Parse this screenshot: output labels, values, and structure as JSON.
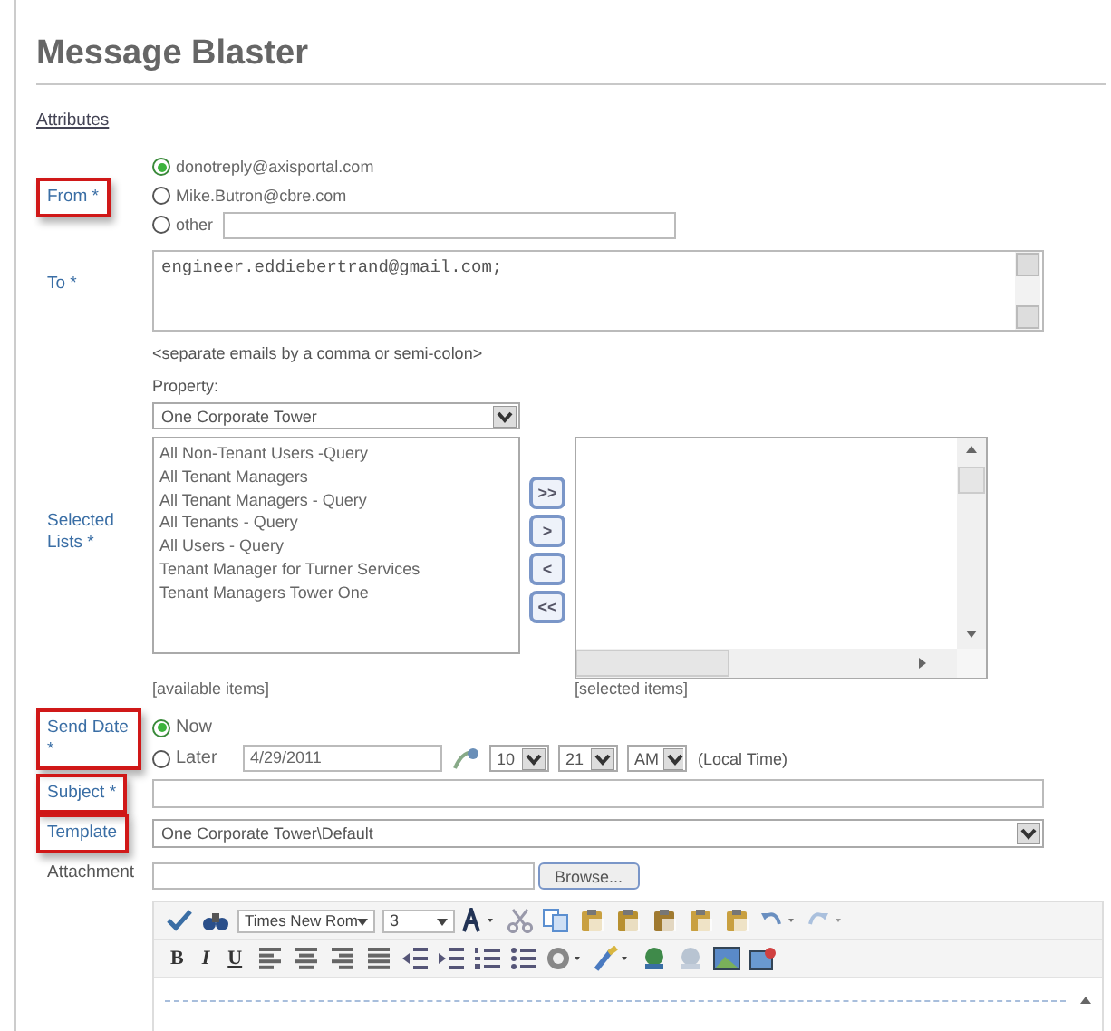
{
  "title": "Message Blaster",
  "attributes_link": "Attributes",
  "from": {
    "label": "From *",
    "highlighted": true,
    "options": [
      {
        "label": "donotreply@axisportal.com",
        "selected": true,
        "kind": "plain"
      },
      {
        "label": "Mike.Butron@cbre.com",
        "selected": false,
        "kind": "plain"
      },
      {
        "label": "other",
        "selected": false,
        "kind": "input"
      }
    ]
  },
  "to": {
    "label": "To *",
    "highlighted": false,
    "value": "engineer.eddiebertrand@gmail.com;",
    "hint": "<separate emails by a comma or semi-colon>"
  },
  "property": {
    "label": "Property:",
    "value": "One Corporate Tower"
  },
  "selected_lists": {
    "label": "Selected Lists *",
    "highlighted": false,
    "available": [
      "All Non-Tenant Users -Query",
      "All Tenant Managers",
      "All Tenant Managers - Query",
      "All Tenants - Query",
      "All Users - Query",
      "Tenant Manager for Turner Services",
      "Tenant Managers Tower One"
    ],
    "move_buttons": [
      ">>",
      ">",
      "<",
      "<<"
    ],
    "available_caption": "[available items]",
    "selected_caption": "[selected items]"
  },
  "send_date": {
    "label": "Send Date *",
    "highlighted": true,
    "options": [
      {
        "label": "Now",
        "selected": true
      },
      {
        "label": "Later",
        "selected": false
      }
    ],
    "date": "4/29/2011",
    "hour": "10",
    "minute": "21",
    "ampm": "AM",
    "time_note": "(Local Time)"
  },
  "subject": {
    "label": "Subject *",
    "highlighted": true
  },
  "template": {
    "label": "Template",
    "highlighted": true,
    "value": "One Corporate Tower\\Default"
  },
  "attachment": {
    "label": "Attachment",
    "highlighted": false,
    "button": "Browse..."
  },
  "editor": {
    "font": "Times New Rom",
    "size": "3",
    "format_buttons": [
      "B",
      "I",
      "U"
    ]
  }
}
